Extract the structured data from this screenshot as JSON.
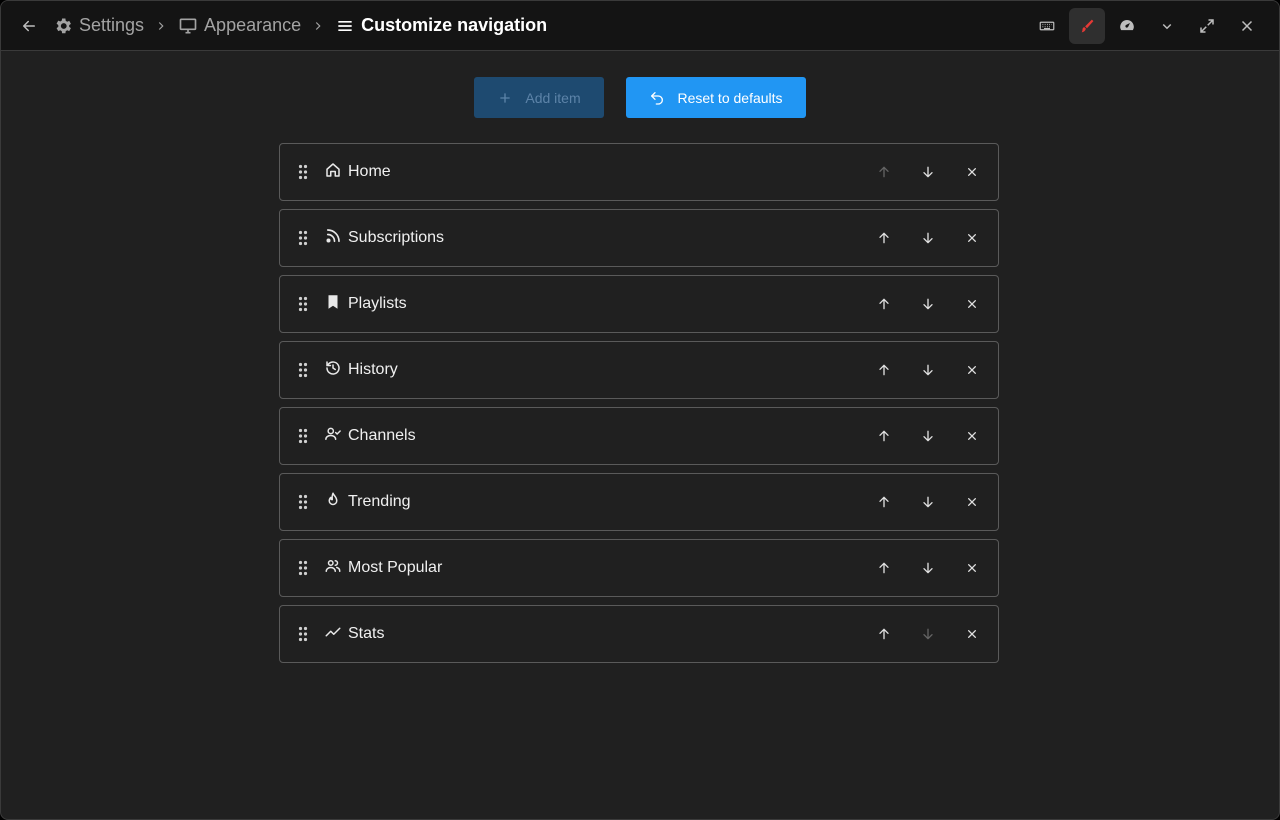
{
  "breadcrumb": [
    {
      "label": "Settings",
      "icon": "gear-icon"
    },
    {
      "label": "Appearance",
      "icon": "monitor-icon"
    },
    {
      "label": "Customize navigation",
      "icon": "menu-icon"
    }
  ],
  "window_controls": [
    "keyboard-icon",
    "brush-icon",
    "speedometer-icon",
    "chevron-down-icon",
    "expand-icon",
    "close-icon"
  ],
  "toolbar": {
    "add_label": "Add item",
    "reset_label": "Reset to defaults"
  },
  "colors": {
    "accent": "#2196f3",
    "accent_disabled": "#1e4a70",
    "brush_active": "#e53935"
  },
  "nav_items": [
    {
      "label": "Home",
      "icon": "home-icon",
      "up_disabled": true,
      "down_disabled": false
    },
    {
      "label": "Subscriptions",
      "icon": "rss-icon",
      "up_disabled": false,
      "down_disabled": false
    },
    {
      "label": "Playlists",
      "icon": "bookmark-icon",
      "up_disabled": false,
      "down_disabled": false
    },
    {
      "label": "History",
      "icon": "history-icon",
      "up_disabled": false,
      "down_disabled": false
    },
    {
      "label": "Channels",
      "icon": "account-check-icon",
      "up_disabled": false,
      "down_disabled": false
    },
    {
      "label": "Trending",
      "icon": "fire-icon",
      "up_disabled": false,
      "down_disabled": false
    },
    {
      "label": "Most Popular",
      "icon": "account-group-icon",
      "up_disabled": false,
      "down_disabled": false
    },
    {
      "label": "Stats",
      "icon": "trending-up-icon",
      "up_disabled": false,
      "down_disabled": true
    }
  ]
}
